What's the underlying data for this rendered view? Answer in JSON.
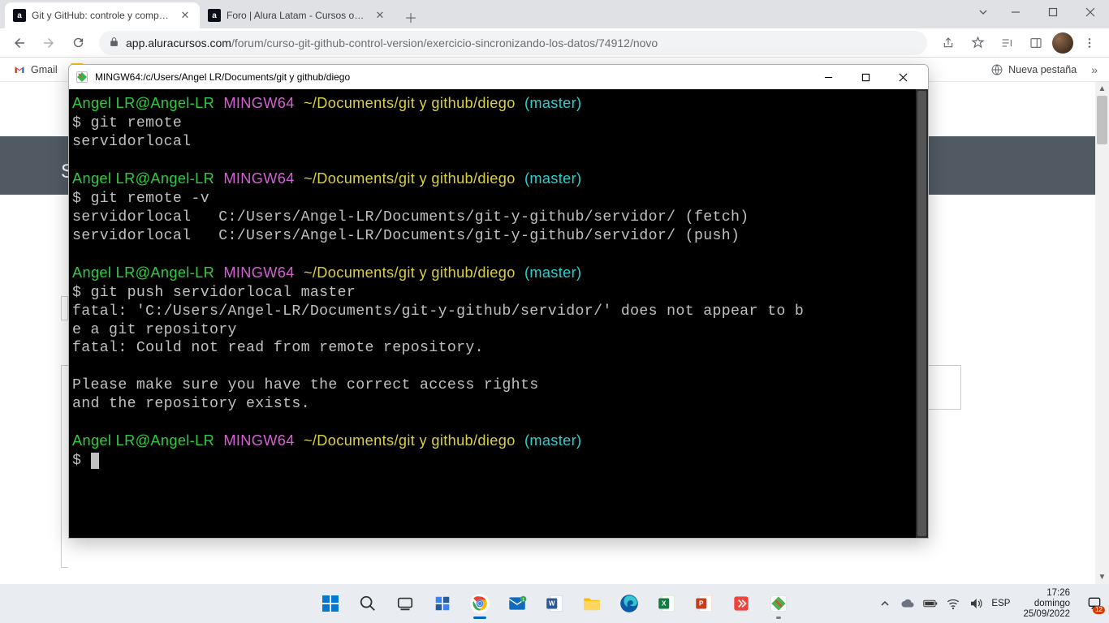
{
  "browser": {
    "tabs": [
      {
        "favicon_bg": "#0b0d17",
        "favicon_text": "a",
        "title": "Git y GitHub: controle y comparta"
      },
      {
        "favicon_bg": "#0b0d17",
        "favicon_text": "a",
        "title": "Foro | Alura Latam - Cursos online"
      }
    ],
    "url_host": "app.aluracursos.com",
    "url_path": "/forum/curso-git-github-control-version/exercicio-sincronizando-los-datos/74912/novo",
    "bookmarks": {
      "gmail": "Gmail",
      "nueva_pestana": "Nueva pestaña"
    }
  },
  "terminal": {
    "title": "MINGW64:/c/Users/Angel LR/Documents/git y github/diego",
    "prompt": {
      "user": "Angel LR@Angel-LR",
      "mingw": "MINGW64",
      "path": "~/Documents/git y github/diego",
      "branch": "(master)"
    },
    "lines": {
      "cmd1": "$ git remote",
      "out1": "servidorlocal",
      "cmd2": "$ git remote -v",
      "out2a": "servidorlocal   C:/Users/Angel-LR/Documents/git-y-github/servidor/ (fetch)",
      "out2b": "servidorlocal   C:/Users/Angel-LR/Documents/git-y-github/servidor/ (push)",
      "cmd3": "$ git push servidorlocal master",
      "out3a": "fatal: 'C:/Users/Angel-LR/Documents/git-y-github/servidor/' does not appear to b",
      "out3b": "e a git repository",
      "out3c": "fatal: Could not read from remote repository.",
      "out3d": "Please make sure you have the correct access rights",
      "out3e": "and the repository exists.",
      "cmd4": "$ "
    }
  },
  "taskbar": {
    "lang": "ESP",
    "time": "17:26",
    "day": "domingo",
    "date": "25/09/2022",
    "notif_count": "12"
  }
}
